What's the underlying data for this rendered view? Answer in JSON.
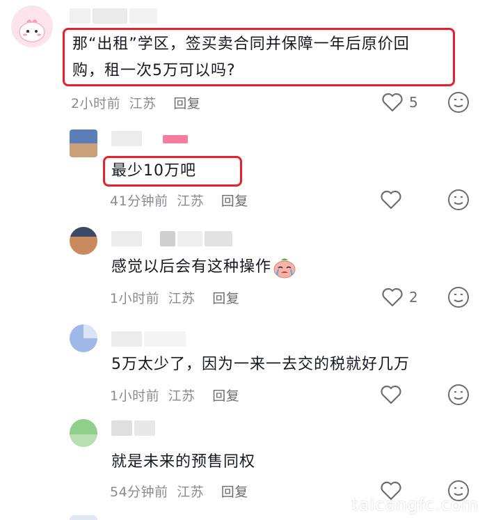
{
  "comments": [
    {
      "text_line1": "那“出租”学区，签买卖合同并保障一年后原价回",
      "text_line2": "购，租一次5万可以吗?",
      "time": "2小时前",
      "location": "江苏",
      "reply": "回复",
      "likes": "5"
    },
    {
      "text": "最少10万吧",
      "time": "41分钟前",
      "location": "江苏",
      "reply": "回复",
      "likes": ""
    },
    {
      "text": "感觉以后会有这种操作",
      "time": "1小时前",
      "location": "江苏",
      "reply": "回复",
      "likes": "2"
    },
    {
      "text": "5万太少了，因为一来一去交的税就好几万",
      "time": "1小时前",
      "location": "江苏",
      "reply": "回复",
      "likes": ""
    },
    {
      "text": "就是未来的预售同权",
      "time": "54分钟前",
      "location": "江苏",
      "reply": "回复",
      "likes": ""
    }
  ],
  "watermark": "taicangfc.com",
  "colors": {
    "highlight": "#e8202a",
    "meta": "#8a8b91",
    "text": "#161823"
  },
  "icons": [
    "heart-icon",
    "emoji-face-icon",
    "crying-emoji-icon",
    "avatar-icon"
  ]
}
